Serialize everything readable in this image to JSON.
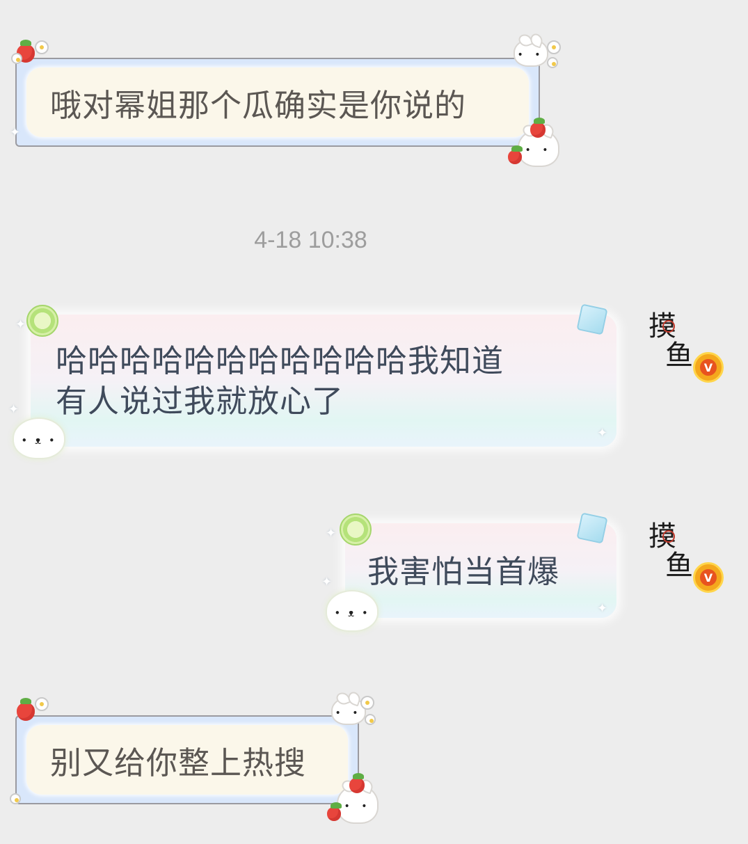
{
  "chat": {
    "messages": [
      {
        "direction": "incoming",
        "text": "哦对幂姐那个瓜确实是你说的"
      },
      {
        "direction": "outgoing",
        "lines": [
          "哈哈哈哈哈哈哈哈哈哈哈我知道",
          "有人说过我就放心了"
        ],
        "avatar_text": "摸鱼"
      },
      {
        "direction": "outgoing",
        "text": "我害怕当首爆",
        "avatar_text": "摸鱼"
      },
      {
        "direction": "incoming",
        "text": "别又给你整上热搜"
      }
    ],
    "timestamp": "4-18 10:38",
    "avatar_badge": "V"
  },
  "colors": {
    "background": "#ededed",
    "incoming_text": "#5b5753",
    "outgoing_text": "#3f4a5b",
    "timestamp": "#9d9d9d",
    "badge": "#f4a81d"
  }
}
